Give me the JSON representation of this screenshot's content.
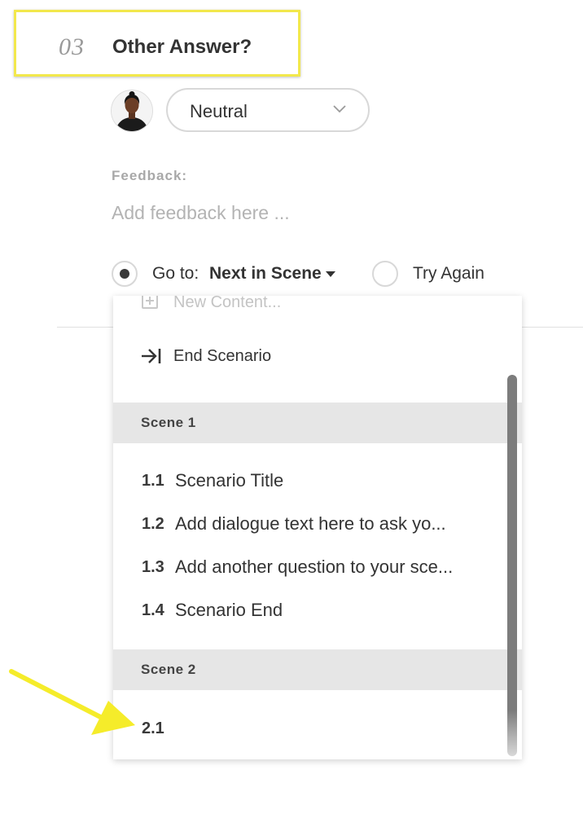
{
  "question": {
    "number": "03",
    "title": "Other Answer?"
  },
  "emotion_select": {
    "value": "Neutral",
    "chevron_icon": "chevron-down-icon"
  },
  "feedback": {
    "label": "Feedback:",
    "placeholder": "Add feedback here ..."
  },
  "branching": {
    "goto_label": "Go to:",
    "goto_target": "Next in Scene",
    "goto_selected": true,
    "try_again_label": "Try Again",
    "try_again_selected": false
  },
  "dropdown": {
    "new_content_label": "New Content...",
    "end_scenario_label": "End Scenario",
    "scenes": [
      {
        "label": "Scene 1",
        "items": [
          {
            "num": "1.1",
            "text": "Scenario Title"
          },
          {
            "num": "1.2",
            "text": "Add dialogue text here to ask yo..."
          },
          {
            "num": "1.3",
            "text": "Add another question to your sce..."
          },
          {
            "num": "1.4",
            "text": "Scenario End"
          }
        ]
      },
      {
        "label": "Scene 2",
        "items": [
          {
            "num": "2.1",
            "text": ""
          }
        ]
      }
    ]
  },
  "colors": {
    "highlight": "#f2e84c",
    "arrow": "#f5ec2a",
    "scene_header_bg": "#e6e6e6",
    "scrollbar": "#7c7c7c"
  }
}
